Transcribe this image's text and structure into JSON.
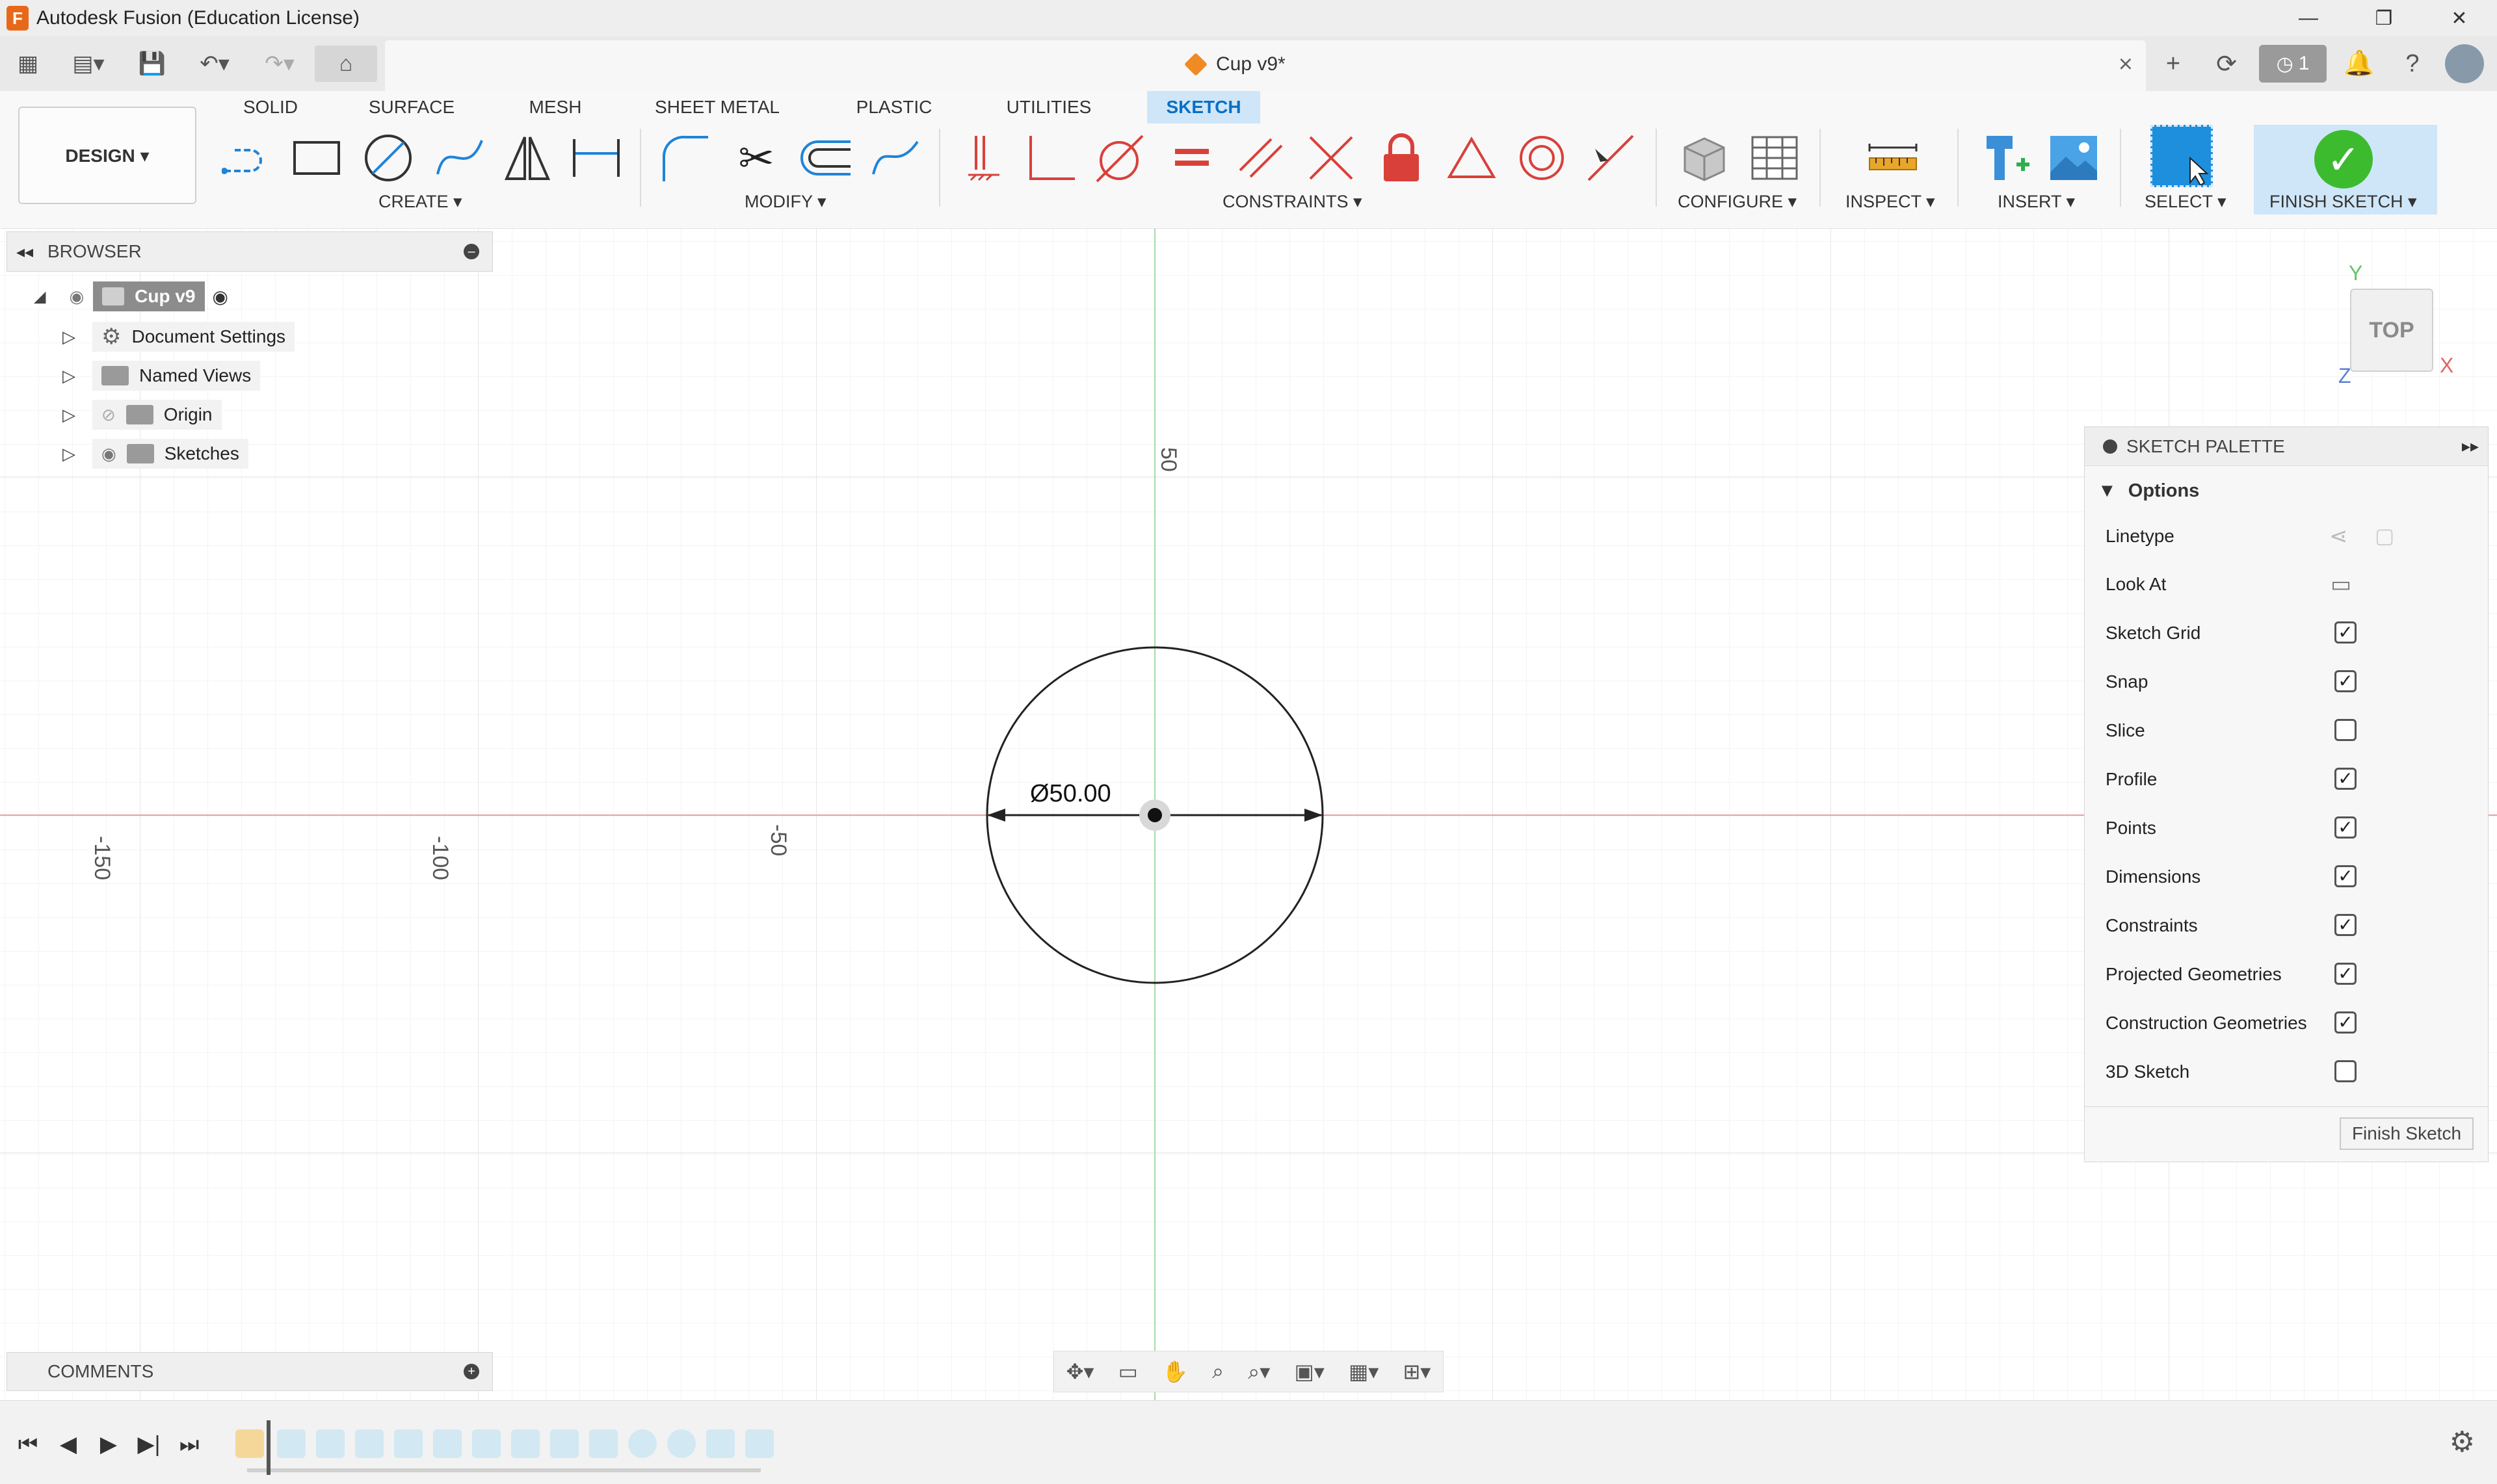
{
  "window": {
    "title": "Autodesk Fusion (Education License)",
    "logo": "F",
    "controls": [
      "—",
      "❐",
      "✕"
    ]
  },
  "quick_access": {
    "document_title": "Cup v9*",
    "job_count": "1"
  },
  "ribbon": {
    "workspace": "DESIGN ▾",
    "tabs": [
      "SOLID",
      "SURFACE",
      "MESH",
      "SHEET METAL",
      "PLASTIC",
      "UTILITIES",
      "SKETCH"
    ],
    "active_tab": "SKETCH",
    "groups": {
      "create": "CREATE ▾",
      "modify": "MODIFY ▾",
      "constraints": "CONSTRAINTS ▾",
      "configure": "CONFIGURE ▾",
      "inspect": "INSPECT ▾",
      "insert": "INSERT ▾",
      "select": "SELECT ▾",
      "finish": "FINISH SKETCH ▾"
    }
  },
  "browser": {
    "title": "BROWSER",
    "root": "Cup v9",
    "items": [
      {
        "label": "Document Settings",
        "icon": "gear-icon"
      },
      {
        "label": "Named Views",
        "icon": "folder-icon"
      },
      {
        "label": "Origin",
        "icon": "folder-icon"
      },
      {
        "label": "Sketches",
        "icon": "folder-icon"
      }
    ]
  },
  "canvas": {
    "dimension_label": "Ø50.00",
    "axis_ticks": {
      "x": [
        "-150",
        "-100",
        "-50"
      ],
      "y": [
        "50"
      ]
    }
  },
  "viewcube": {
    "face": "TOP",
    "axes": {
      "y": "Y",
      "x": "X",
      "z": "Z"
    }
  },
  "sketch_palette": {
    "title": "SKETCH PALETTE",
    "section": "Options",
    "options": [
      {
        "label": "Linetype",
        "type": "icons"
      },
      {
        "label": "Look At",
        "type": "icon"
      },
      {
        "label": "Sketch Grid",
        "checked": true
      },
      {
        "label": "Snap",
        "checked": true
      },
      {
        "label": "Slice",
        "checked": false
      },
      {
        "label": "Profile",
        "checked": true
      },
      {
        "label": "Points",
        "checked": true
      },
      {
        "label": "Dimensions",
        "checked": true
      },
      {
        "label": "Constraints",
        "checked": true
      },
      {
        "label": "Projected Geometries",
        "checked": true
      },
      {
        "label": "Construction Geometries",
        "checked": true
      },
      {
        "label": "3D Sketch",
        "checked": false
      }
    ],
    "finish_button": "Finish Sketch"
  },
  "comments": {
    "title": "COMMENTS"
  },
  "colors": {
    "accent": "#0a6fc4",
    "active_tab_bg": "#cfe6f8",
    "finish_green": "#3dbb2f",
    "x_axis": "#e57373",
    "y_axis": "#7ccf7c"
  }
}
